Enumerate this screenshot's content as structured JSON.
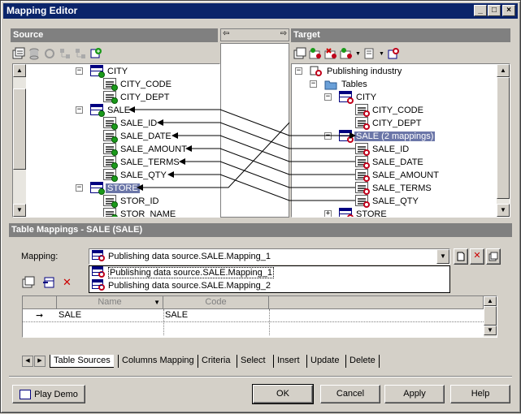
{
  "window": {
    "title": "Mapping Editor"
  },
  "source": {
    "header": "Source",
    "tree": [
      {
        "label": "CITY",
        "kind": "table",
        "expander": "−"
      },
      {
        "label": "CITY_CODE",
        "kind": "column"
      },
      {
        "label": "CITY_DEPT",
        "kind": "column"
      },
      {
        "label": "SALE",
        "kind": "table",
        "expander": "−"
      },
      {
        "label": "SALE_ID",
        "kind": "column"
      },
      {
        "label": "SALE_DATE",
        "kind": "column"
      },
      {
        "label": "SALE_AMOUNT",
        "kind": "column"
      },
      {
        "label": "SALE_TERMS",
        "kind": "column"
      },
      {
        "label": "SALE_QTY",
        "kind": "column"
      },
      {
        "label": "STORE",
        "kind": "table",
        "expander": "−",
        "selected": true
      },
      {
        "label": "STOR_ID",
        "kind": "column"
      },
      {
        "label": "STOR_NAME",
        "kind": "column"
      }
    ]
  },
  "target": {
    "header": "Target",
    "tree": [
      {
        "label": "Publishing industry",
        "kind": "model",
        "expander": "−"
      },
      {
        "label": "Tables",
        "kind": "folder",
        "expander": "−"
      },
      {
        "label": "CITY",
        "kind": "table",
        "expander": "−"
      },
      {
        "label": "CITY_CODE",
        "kind": "column"
      },
      {
        "label": "CITY_DEPT",
        "kind": "column"
      },
      {
        "label": "SALE (2 mappings)",
        "kind": "table",
        "expander": "−",
        "selected": true
      },
      {
        "label": "SALE_ID",
        "kind": "column"
      },
      {
        "label": "SALE_DATE",
        "kind": "column"
      },
      {
        "label": "SALE_AMOUNT",
        "kind": "column"
      },
      {
        "label": "SALE_TERMS",
        "kind": "column"
      },
      {
        "label": "SALE_QTY",
        "kind": "column"
      },
      {
        "label": "STORE",
        "kind": "table",
        "expander": "+"
      }
    ]
  },
  "table_mappings": {
    "header": "Table Mappings - SALE (SALE)",
    "mapping_label": "Mapping:",
    "mapping_value": "Publishing data source.SALE.Mapping_1",
    "dropdown_options": [
      "Publishing data source.SALE.Mapping_1",
      "Publishing data source.SALE.Mapping_2"
    ],
    "grid": {
      "columns": [
        "Name",
        "Code"
      ],
      "rows": [
        {
          "name": "SALE",
          "code": "SALE"
        }
      ]
    },
    "tabs": [
      "Table Sources",
      "Columns Mapping",
      "Criteria",
      "Select",
      "Insert",
      "Update",
      "Delete"
    ]
  },
  "buttons": {
    "play_demo": "Play Demo",
    "ok": "OK",
    "cancel": "Cancel",
    "apply": "Apply",
    "help": "Help"
  },
  "colors": {
    "titlebar": "#0a246a",
    "pane_header": "#808080",
    "selection": "#0a246a"
  }
}
